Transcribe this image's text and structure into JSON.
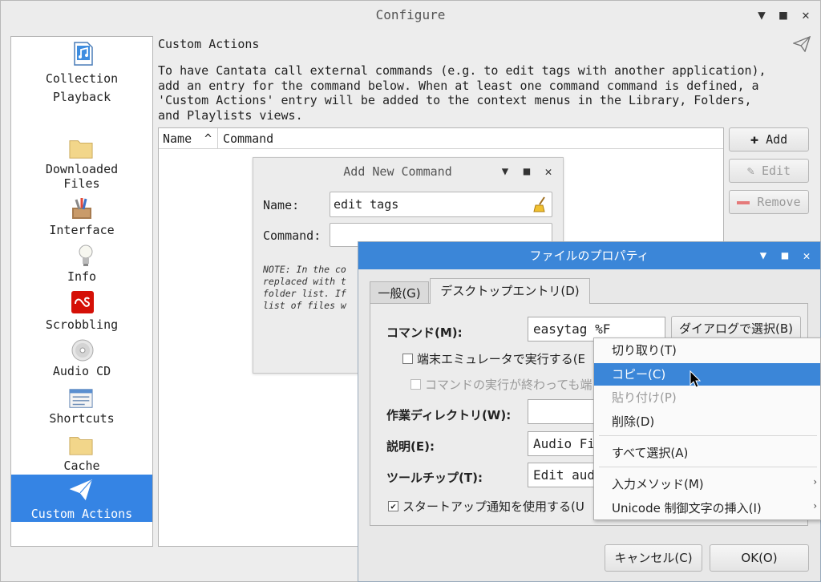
{
  "window": {
    "title": "Configure",
    "minimize": "▼",
    "maximize": "■",
    "close": "✕"
  },
  "sidebar": {
    "items": [
      {
        "label": "Collection",
        "icon": "music-file-icon"
      },
      {
        "label": "Playback",
        "icon": ""
      },
      {
        "label": "Downloaded\nFiles",
        "icon": "folder-icon"
      },
      {
        "label": "Interface",
        "icon": "tools-icon"
      },
      {
        "label": "Info",
        "icon": "lightbulb-icon"
      },
      {
        "label": "Scrobbling",
        "icon": "lastfm-icon"
      },
      {
        "label": "Audio CD",
        "icon": "cd-icon"
      },
      {
        "label": "Shortcuts",
        "icon": "keyboard-icon"
      },
      {
        "label": "Cache",
        "icon": "folder-icon"
      },
      {
        "label": "Custom Actions",
        "icon": "paper-plane-icon"
      }
    ],
    "selected_index": 9
  },
  "page": {
    "title": "Custom Actions",
    "description_lines": [
      "To have Cantata call external commands (e.g. to edit tags with another application),",
      "add an entry for the command below. When at least one command command is defined, a",
      "'Custom Actions' entry will be added to the context menus in the Library, Folders,",
      "and Playlists views."
    ],
    "table": {
      "col_name": "Name",
      "sort_indicator": "^",
      "col_command": "Command"
    },
    "buttons": {
      "add": "Add",
      "edit": "Edit",
      "remove": "Remove"
    }
  },
  "add_dialog": {
    "title": "Add New Command",
    "name_label": "Name:",
    "name_value": "edit tags",
    "command_label": "Command:",
    "command_value": "",
    "note_lines": [
      "NOTE: In the co",
      "replaced with t",
      "folder list. If",
      "list of files w"
    ]
  },
  "properties_dialog": {
    "title": "ファイルのプロパティ",
    "tabs": [
      "一般(G)",
      "デスクトップエントリ(D)"
    ],
    "active_tab": 1,
    "command_label": "コマンド(M):",
    "command_value": "easytag %F",
    "browse_button": "ダイアログで選択(B)",
    "terminal_check": "端末エミュレータで実行する(E",
    "keep_open_check": "コマンドの実行が終わっても端",
    "workdir_label": "作業ディレクトリ(W):",
    "workdir_value": "",
    "desc_label": "説明(E):",
    "desc_value": "Audio Fi",
    "tooltip_label": "ツールチップ(T):",
    "tooltip_value": "Edit aud",
    "startup_check": "スタートアップ通知を使用する(U",
    "startup_checked": true,
    "cancel": "キャンセル(C)",
    "ok": "OK(O)"
  },
  "context_menu": {
    "items": [
      {
        "label": "切り取り(T)",
        "state": "normal"
      },
      {
        "label": "コピー(C)",
        "state": "highlighted"
      },
      {
        "label": "貼り付け(P)",
        "state": "disabled"
      },
      {
        "label": "削除(D)",
        "state": "normal"
      },
      {
        "label": "すべて選択(A)",
        "state": "normal"
      },
      {
        "label": "入力メソッド(M)",
        "state": "submenu"
      },
      {
        "label": "Unicode 制御文字の挿入(I)",
        "state": "submenu"
      }
    ]
  },
  "colors": {
    "selection": "#3584e4",
    "gtk_titlebar": "#3b86d8"
  }
}
